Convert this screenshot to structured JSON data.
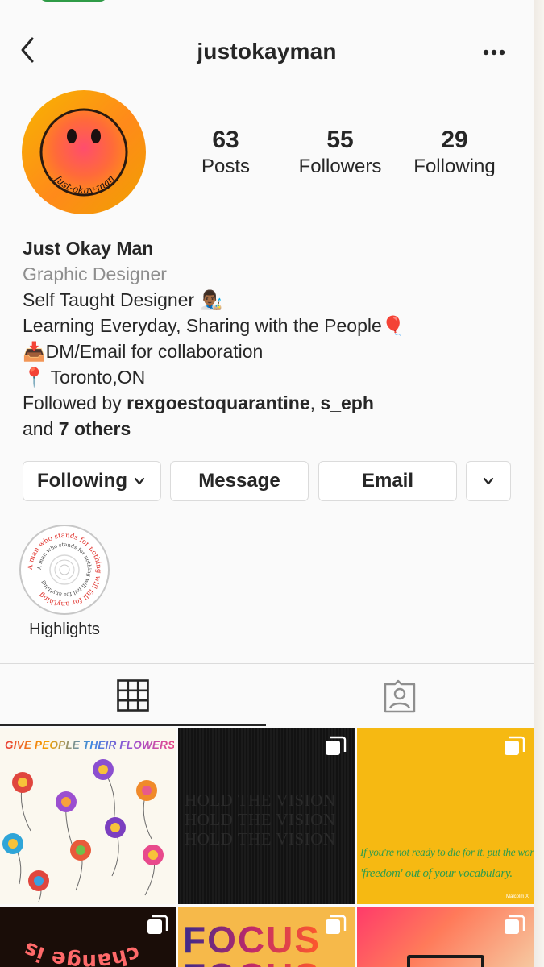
{
  "header": {
    "username": "justokayman",
    "back_icon": "chevron-left-icon",
    "more_icon": "ellipsis-icon"
  },
  "avatar": {
    "text": "Just-okay-man",
    "colors": {
      "orange": "#f5a000",
      "pink": "#ff3d7f"
    }
  },
  "stats": [
    {
      "value": "63",
      "label": "Posts"
    },
    {
      "value": "55",
      "label": "Followers"
    },
    {
      "value": "29",
      "label": "Following"
    }
  ],
  "bio": {
    "name": "Just Okay Man",
    "category": "Graphic Designer",
    "line1": "Self Taught Designer 👨🏾‍🎨",
    "line2": "Learning Everyday, Sharing with the People🎈",
    "line3": "📥DM/Email for collaboration",
    "line4": "📍 Toronto,ON",
    "followed_prefix": "Followed by ",
    "followed_user1": "rexgoestoquarantine",
    "followed_sep": ", ",
    "followed_user2": "s_eph",
    "followed_and": "and ",
    "followed_others": "7 others"
  },
  "buttons": {
    "following": "Following",
    "message": "Message",
    "email": "Email"
  },
  "highlights": {
    "label": "Highlights",
    "ring_text": "A man who stands for nothing will fall for anything"
  },
  "tabs": {
    "grid_icon": "grid-icon",
    "tagged_icon": "tagged-user-icon"
  },
  "posts": {
    "p1_title": "GIVE PEOPLE THEIR FLOWERS",
    "p2_text": "HOLD THE VISION",
    "p3_line1": "If you're not ready to die for it, put the word",
    "p3_line2": "'freedom' out of your vocabulary.",
    "p3_credit": "Malcolm X",
    "p4_text": "change is",
    "p5_text": "FOCUS",
    "accent_yellow": "#f6b912",
    "accent_green": "#2e9c4c"
  }
}
